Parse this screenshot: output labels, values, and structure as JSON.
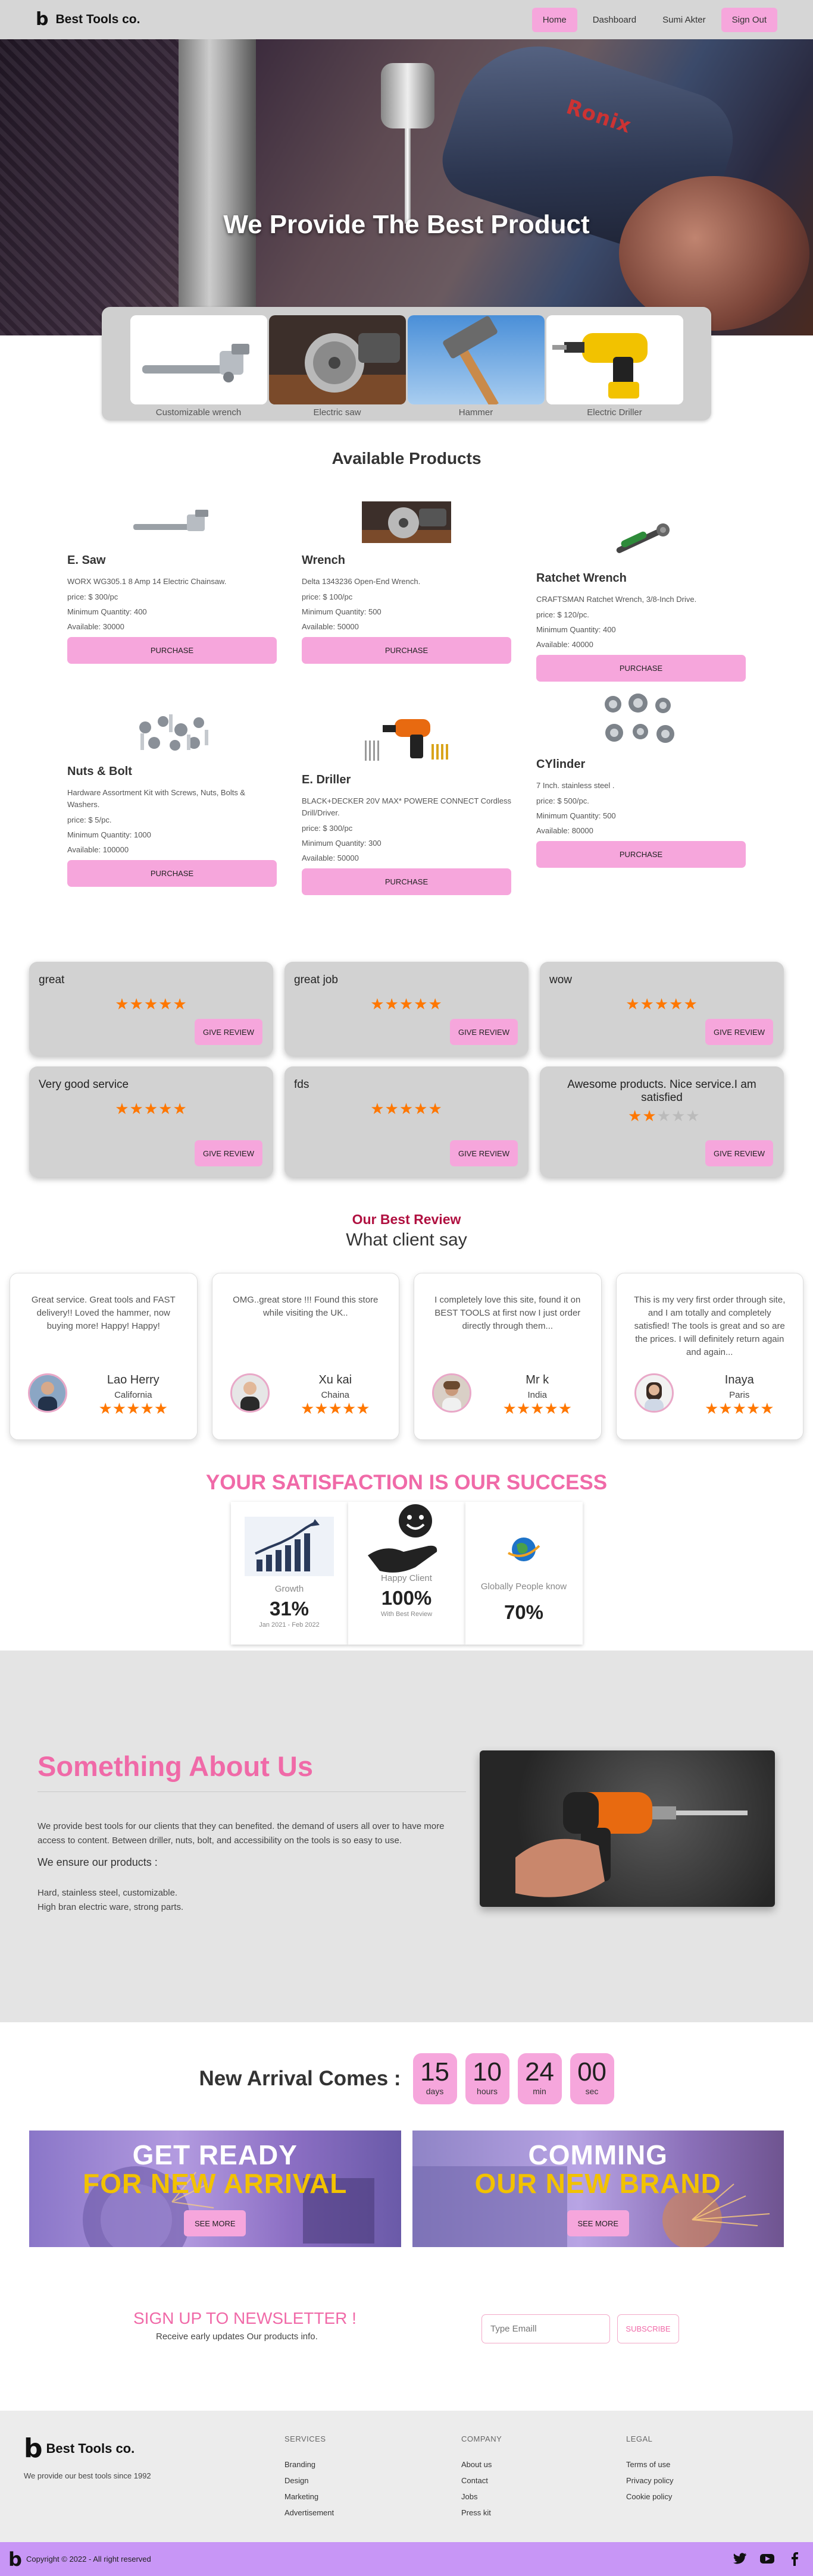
{
  "nav": {
    "brand": "Best Tools co.",
    "links": [
      "Home",
      "Dashboard",
      "Sumi Akter",
      "Sign Out"
    ]
  },
  "hero": {
    "title": "We Provide The Best Product",
    "drill_brand": "Ronix"
  },
  "categories": [
    {
      "label": "Customizable wrench",
      "icon": "pipe-wrench-icon"
    },
    {
      "label": "Electric saw",
      "icon": "electric-saw-icon"
    },
    {
      "label": "Hammer",
      "icon": "hammer-icon"
    },
    {
      "label": "Electric Driller",
      "icon": "electric-drill-icon"
    }
  ],
  "products_section": {
    "title": "Available Products",
    "purchase_label": "PURCHASE",
    "items": [
      {
        "name": "E. Saw",
        "desc": "WORX WG305.1 8 Amp 14 Electric Chainsaw.",
        "price": "price: $ 300/pc",
        "min": "Minimum Quantity: 400",
        "available": "Available: 30000",
        "icon": "pipe-wrench-icon"
      },
      {
        "name": "Wrench",
        "desc": "Delta 1343236 Open-End Wrench.",
        "price": "price: $ 100/pc",
        "min": "Minimum Quantity: 500",
        "available": "Available: 50000",
        "icon": "electric-saw-icon"
      },
      {
        "name": "Ratchet Wrench",
        "desc": "CRAFTSMAN Ratchet Wrench, 3/8-Inch Drive.",
        "price": "price: $ 120/pc.",
        "min": "Minimum Quantity: 400",
        "available": "Available: 40000",
        "icon": "ratchet-wrench-icon"
      },
      {
        "name": "Nuts & Bolt",
        "desc": "Hardware Assortment Kit with Screws, Nuts, Bolts & Washers.",
        "price": "price: $ 5/pc.",
        "min": "Minimum Quantity: 1000",
        "available": "Available: 100000",
        "icon": "nuts-bolts-icon"
      },
      {
        "name": "E. Driller",
        "desc": "BLACK+DECKER 20V MAX* POWERE CONNECT Cordless Drill/Driver.",
        "price": "price: $ 300/pc",
        "min": "Minimum Quantity: 300",
        "available": "Available: 50000",
        "icon": "drill-kit-icon"
      },
      {
        "name": "CYlinder",
        "desc": "7 Inch. stainless steel .",
        "price": "price: $ 500/pc.",
        "min": "Minimum Quantity: 500",
        "available": "Available: 80000",
        "icon": "cylinder-parts-icon"
      }
    ]
  },
  "reviews": {
    "button_label": "GIVE REVIEW",
    "items": [
      {
        "text": "great",
        "rating": 5
      },
      {
        "text": "great job",
        "rating": 5
      },
      {
        "text": "wow",
        "rating": 5
      },
      {
        "text": "Very good service",
        "rating": 5
      },
      {
        "text": "fds",
        "rating": 5
      },
      {
        "text": "Awesome products. Nice service.I am satisfied",
        "rating": 2
      }
    ]
  },
  "best_review": {
    "title": "Our Best Review",
    "subtitle": "What client say",
    "items": [
      {
        "text": "Great service. Great tools and FAST delivery!! Loved the hammer, now buying more! Happy! Happy!",
        "name": "Lao Herry",
        "location": "California",
        "rating": 5
      },
      {
        "text": "OMG..great store !!! Found this store while visiting the UK..",
        "name": "Xu kai",
        "location": "Chaina",
        "rating": 5
      },
      {
        "text": "I completely love this site, found it on BEST TOOLS at first now I just order directly through them...",
        "name": "Mr k",
        "location": "India",
        "rating": 5
      },
      {
        "text": "This is my very first order through site, and I am totally and completely satisfied! The tools is great and so are the prices. I will definitely return again and again...",
        "name": "Inaya",
        "location": "Paris",
        "rating": 5
      }
    ]
  },
  "satisfaction": {
    "title": "YOUR SATISFACTION IS OUR SUCCESS",
    "boxes": [
      {
        "label": "Growth",
        "value": "31%",
        "note": "Jan 2021 - Feb 2022",
        "icon": "growth-chart-icon"
      },
      {
        "label": "Happy Client",
        "value": "100%",
        "note": "With Best Review",
        "icon": "happy-client-icon"
      },
      {
        "label": "Globally People know",
        "value": "70%",
        "note": "",
        "icon": "globe-icon"
      }
    ]
  },
  "about": {
    "title": "Something About Us",
    "paragraph": "We provide best tools for our clients that they can benefited. the demand of users all over to have more access to content. Between driller, nuts, bolt, and accessibility on the tools is so easy to use.",
    "heading": "We ensure our products :",
    "list": [
      "Hard, stainless steel, customizable.",
      "High bran electric ware, strong parts."
    ]
  },
  "arrival": {
    "title": "New Arrival Comes :",
    "countdown": [
      {
        "num": "15",
        "label": "days"
      },
      {
        "num": "10",
        "label": "hours"
      },
      {
        "num": "24",
        "label": "min"
      },
      {
        "num": "00",
        "label": "sec"
      }
    ],
    "banners": [
      {
        "line1": "GET READY",
        "line2": "FOR NEW ARRIVAL",
        "button": "SEE MORE"
      },
      {
        "line1": "COMMING",
        "line2": "OUR NEW BRAND",
        "button": "SEE MORE"
      }
    ]
  },
  "newsletter": {
    "title": "SIGN UP TO NEWSLETTER !",
    "subtitle": "Receive early updates Our products info.",
    "placeholder": "Type Emaill",
    "button": "SUBSCRIBE"
  },
  "footer": {
    "brand": "Best Tools co.",
    "tagline": "We provide our best tools since 1992",
    "columns": [
      {
        "head": "SERVICES",
        "links": [
          "Branding",
          "Design",
          "Marketing",
          "Advertisement"
        ]
      },
      {
        "head": "COMPANY",
        "links": [
          "About us",
          "Contact",
          "Jobs",
          "Press kit"
        ]
      },
      {
        "head": "LEGAL",
        "links": [
          "Terms of use",
          "Privacy policy",
          "Cookie policy"
        ]
      }
    ],
    "copyright": "Copyright © 2022 - All right reserved",
    "socials": [
      "twitter-icon",
      "youtube-icon",
      "facebook-icon"
    ]
  },
  "colors": {
    "accent_pink": "#f6a6dc",
    "title_pink": "#f06aa8",
    "review_red": "#b01040",
    "star_orange": "#ff7700",
    "footer_bar": "#c896f6"
  }
}
